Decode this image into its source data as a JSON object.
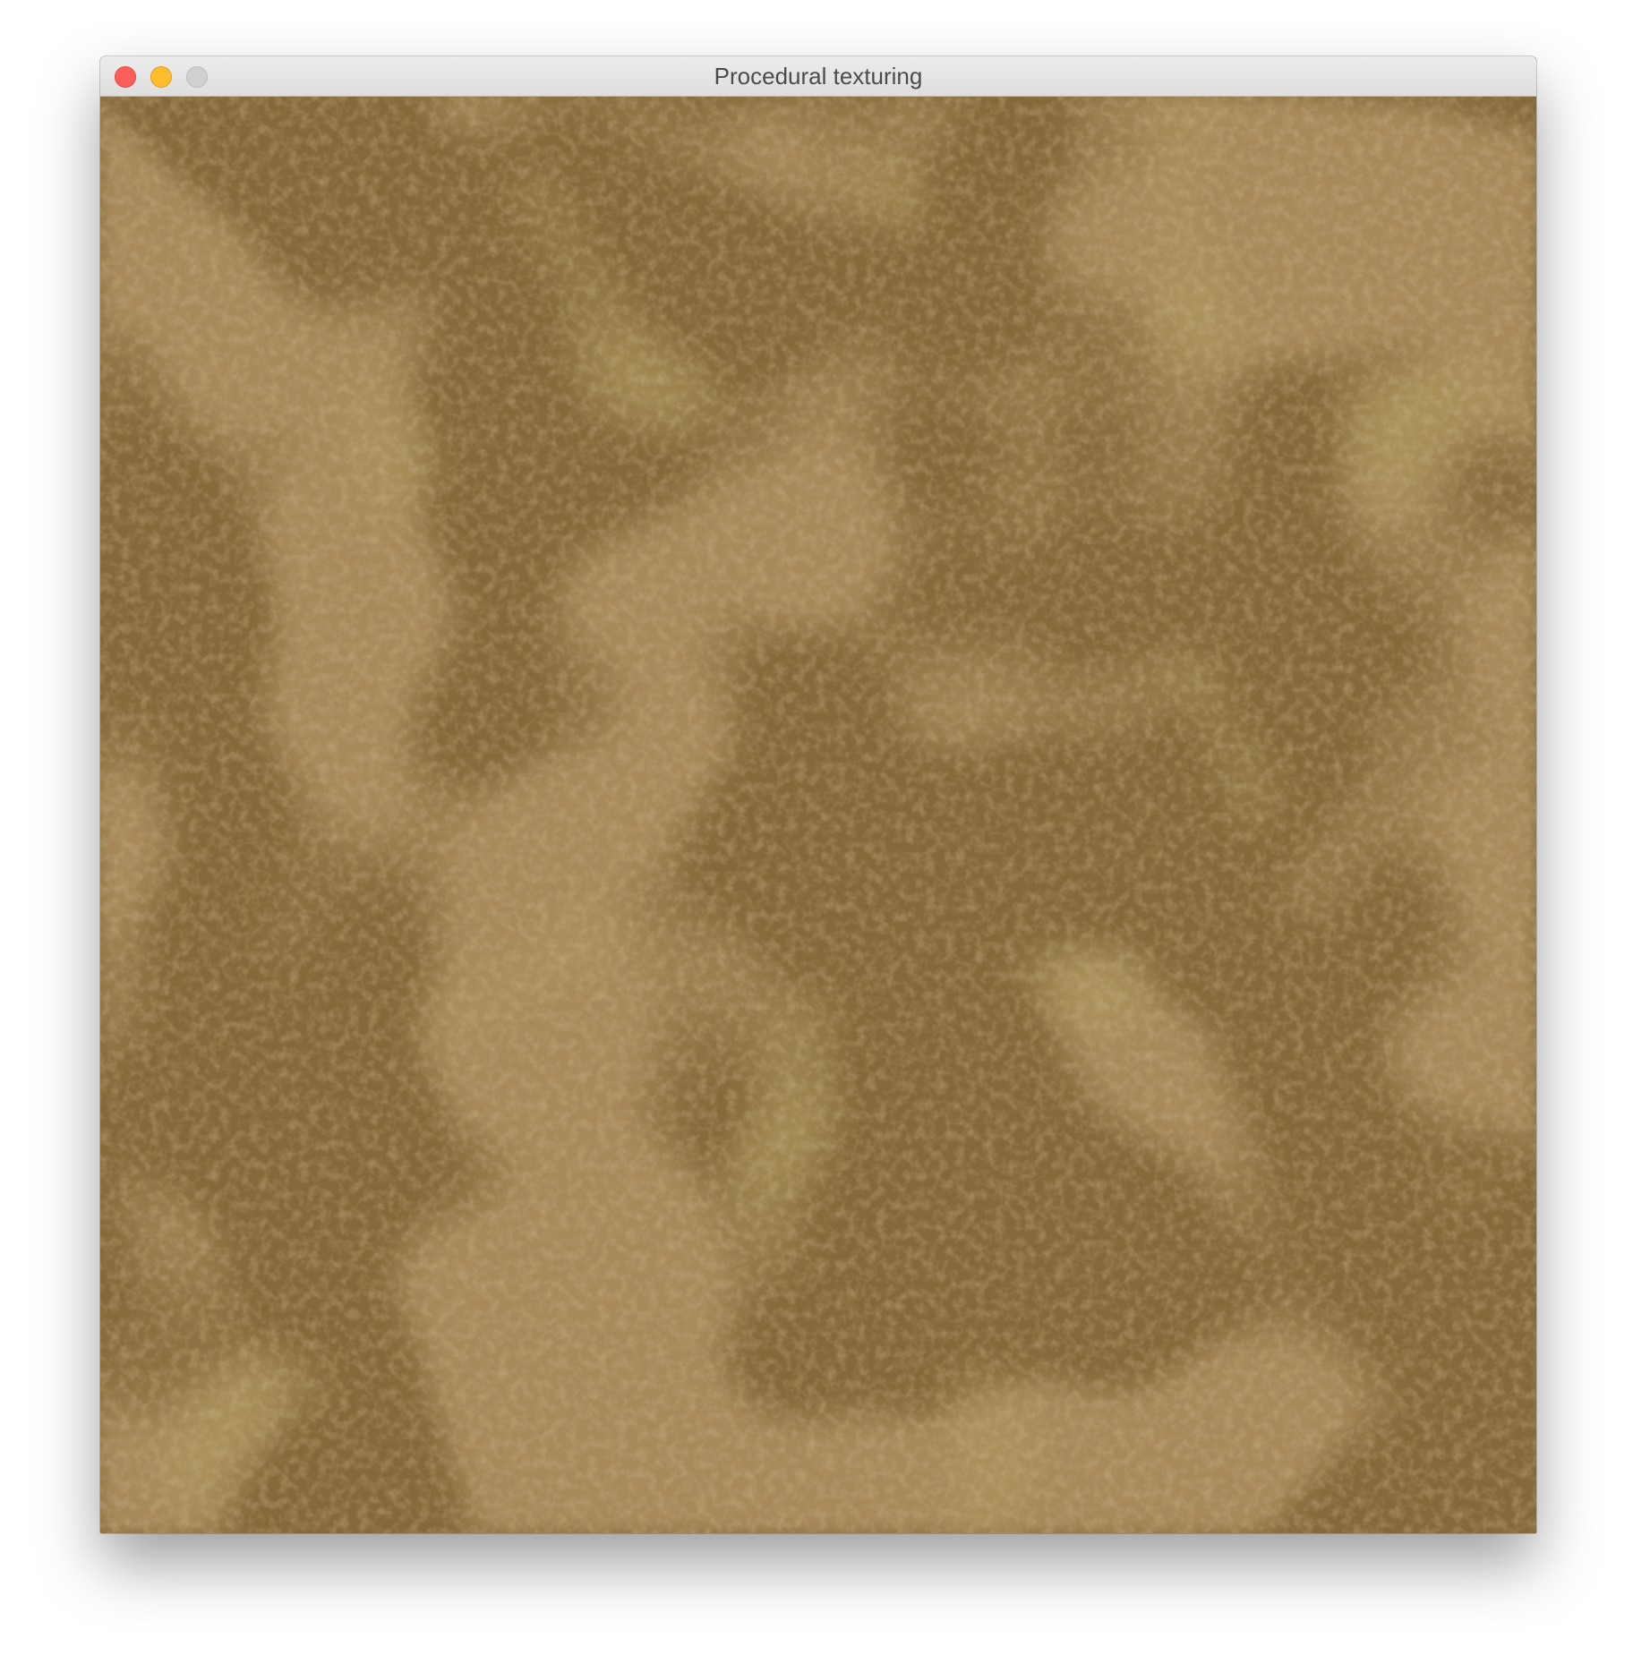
{
  "window": {
    "title": "Procedural texturing",
    "controls": {
      "close": "close-icon",
      "minimize": "minimize-icon",
      "zoom": "zoom-icon"
    }
  },
  "texture": {
    "base_color": "#8a6d3b",
    "light_color": "#a8895a",
    "dark_color": "#6e5420"
  },
  "colors": {
    "close": "#fc5f57",
    "minimize": "#fdbc2e",
    "zoom_disabled": "#d0d0d0"
  }
}
